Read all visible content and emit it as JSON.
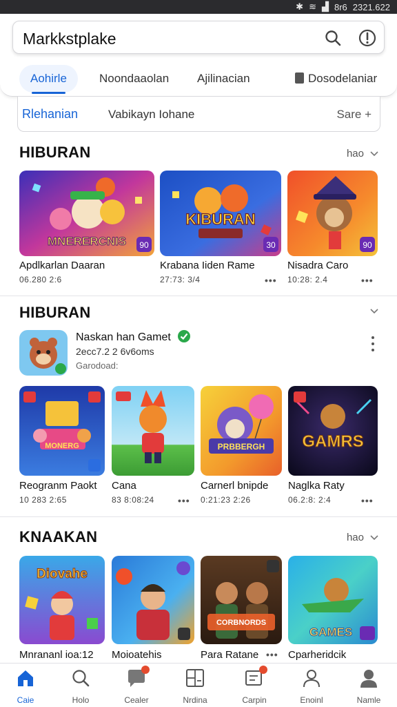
{
  "status_bar": {
    "time": "2321.622",
    "carrier": "8r6"
  },
  "search": {
    "placeholder": "Markkstplake"
  },
  "tabs": [
    {
      "label": "Aohirle",
      "active": true
    },
    {
      "label": "Noondaaolan",
      "active": false
    },
    {
      "label": "Ajilinacian",
      "active": false
    },
    {
      "label": "Dosodelaniar",
      "active": false
    }
  ],
  "filter_bar": {
    "active": "Rlehanian",
    "middle": "Vabikayn Iohane",
    "right": "Sare +"
  },
  "sections": [
    {
      "title": "HIBURAN",
      "more": "hao",
      "tiles": [
        {
          "name": "Apdlkarlan Daaran",
          "meta": "06.280 2:6",
          "badge": "90",
          "caption": "MNERERCNIS"
        },
        {
          "name": "Krabana Iiden Rame",
          "meta": "27:73: 3/4",
          "badge": "30",
          "caption": "KIBURAN"
        },
        {
          "name": "Nisadra Caro",
          "meta": "10:28: 2.4",
          "badge": "90",
          "caption": ""
        }
      ]
    },
    {
      "title": "HIBURAN",
      "featured": {
        "name": "Naskan han Gamet",
        "sub": "2ecc7.2 2 6v6oms",
        "sub2": "Garodoad:"
      },
      "tiles": [
        {
          "name": "Reogranm Paokt",
          "meta": "10 283 2:65",
          "caption": "MONERG"
        },
        {
          "name": "Cana",
          "meta": "83 8:08:24",
          "caption": ""
        },
        {
          "name": "Carnerl bnipde",
          "meta": "0:21:23 2:26",
          "caption": "PRBBERGH"
        },
        {
          "name": "Naglka Raty",
          "meta": "06.2:8: 2:4",
          "caption": "GAMRS"
        }
      ]
    },
    {
      "title": "KNAAKAN",
      "more": "hao",
      "tiles": [
        {
          "name": "Mnrananl ioa:12",
          "caption": "Diovahe"
        },
        {
          "name": "Moioatehis",
          "caption": ""
        },
        {
          "name": "Para Ratane",
          "caption": "CORBNORDS"
        },
        {
          "name": "Cparheridcik",
          "caption": "GAMES"
        }
      ]
    }
  ],
  "bottom_nav": [
    {
      "label": "Caie",
      "icon": "home-icon",
      "active": true
    },
    {
      "label": "Holo",
      "icon": "search-icon",
      "active": false
    },
    {
      "label": "Cealer",
      "icon": "chat-icon",
      "active": false
    },
    {
      "label": "Nrdina",
      "icon": "grid-icon",
      "active": false
    },
    {
      "label": "Carpin",
      "icon": "inbox-icon",
      "active": false
    },
    {
      "label": "Enoinl",
      "icon": "person-icon",
      "active": false
    },
    {
      "label": "Namle",
      "icon": "profile-icon",
      "active": false
    }
  ],
  "colors": {
    "accent": "#1764d6",
    "badge": "#e44b2e",
    "verified": "#2aa84a"
  }
}
